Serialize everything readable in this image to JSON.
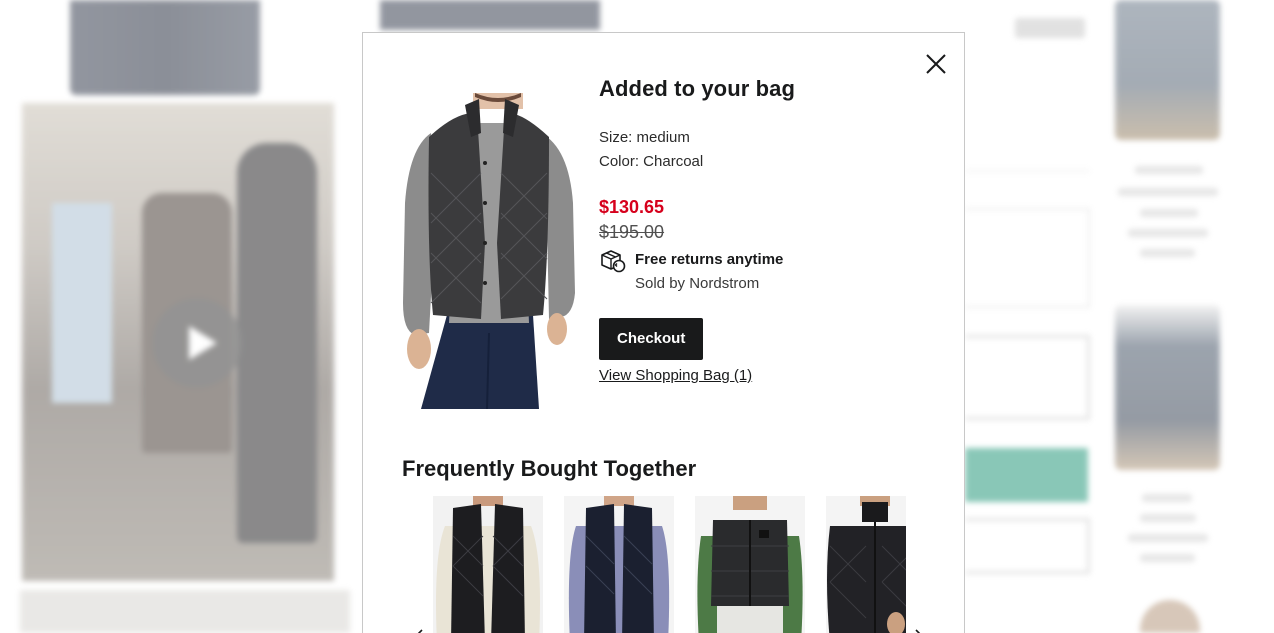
{
  "modal": {
    "title": "Added to your bag",
    "size": "Size: medium",
    "color": "Color: Charcoal",
    "sale_price": "$130.65",
    "original_price": "$195.00",
    "returns_title": "Free returns anytime",
    "seller": "Sold by Nordstrom",
    "checkout_label": "Checkout",
    "view_bag_label": "View Shopping Bag (1)",
    "close_icon": "close-icon",
    "returns_icon": "box-return-icon"
  },
  "frequently_bought": {
    "title": "Frequently Bought Together",
    "items": [
      {
        "name": "black-quilted-vest-cream-sweater"
      },
      {
        "name": "black-quilted-vest-check-shirt"
      },
      {
        "name": "black-puffer-vest-green-sleeves"
      },
      {
        "name": "black-quilted-jacket"
      }
    ]
  },
  "colors": {
    "sale_red": "#d6001c",
    "button_black": "#191a1b",
    "background_teal": "#2a9a7d"
  }
}
